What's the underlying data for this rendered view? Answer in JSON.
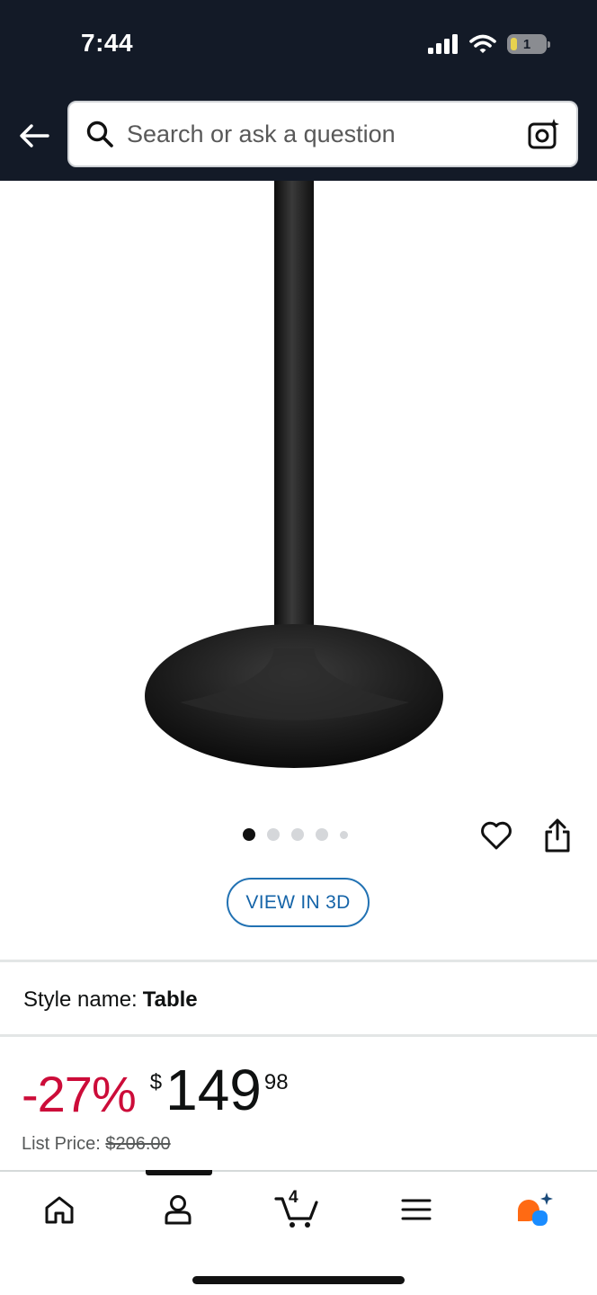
{
  "status_bar": {
    "time": "7:44",
    "battery_level": "1"
  },
  "search": {
    "placeholder": "Search or ask a question"
  },
  "gallery": {
    "total_images": 5,
    "active_index": 0
  },
  "view_3d_label": "VIEW IN 3D",
  "style": {
    "label": "Style name:",
    "value": "Table"
  },
  "price": {
    "discount": "-27%",
    "currency": "$",
    "whole": "149",
    "fraction": "98",
    "list_price_label": "List Price:",
    "list_price_value": "$206.00"
  },
  "cart": {
    "count": "4"
  },
  "colors": {
    "header_bg": "#131a27",
    "discount_red": "#cc0c39",
    "link_blue": "#1564a8"
  }
}
